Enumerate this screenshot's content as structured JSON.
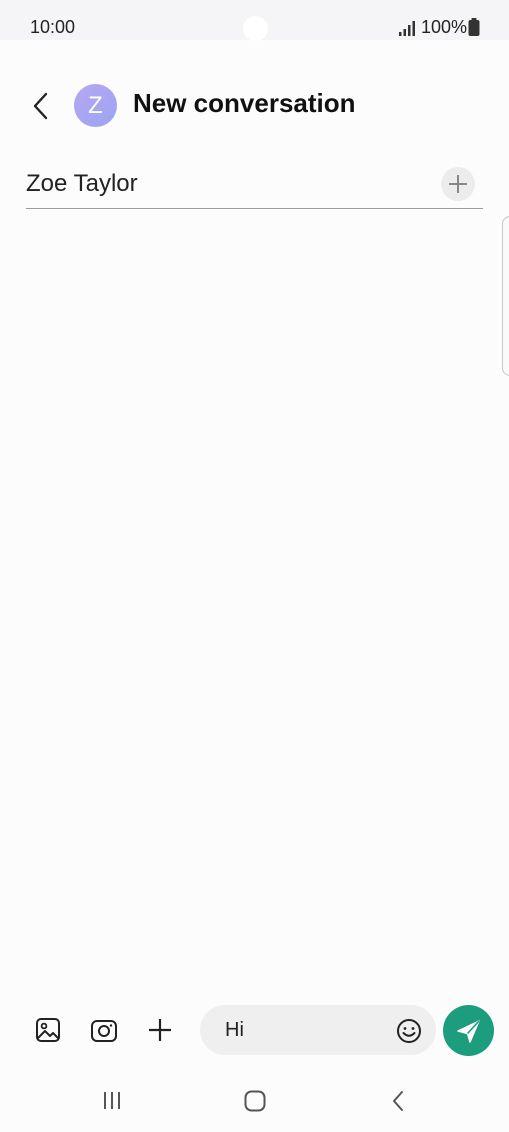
{
  "status_bar": {
    "time": "10:00",
    "battery": "100%",
    "icons": [
      "signal-icon",
      "battery-icon"
    ]
  },
  "header": {
    "back_icon": "chevron-left-icon",
    "avatar_letter": "Z",
    "title": "New conversation"
  },
  "recipient": {
    "name": "Zoe Taylor",
    "add_icon": "plus-icon"
  },
  "composer": {
    "attach_image_icon": "image-icon",
    "camera_icon": "camera-icon",
    "add_icon": "plus-icon",
    "message_text": "Hi",
    "emoji_icon": "smiley-icon",
    "send_icon": "send-icon"
  },
  "nav_bar": {
    "icons": [
      "recents-icon",
      "home-icon",
      "back-icon"
    ]
  },
  "colors": {
    "send_button": "#1b9d7e",
    "avatar_start": "#b7a6f0",
    "avatar_end": "#9aa5f3",
    "background": "#fcfcfc"
  }
}
